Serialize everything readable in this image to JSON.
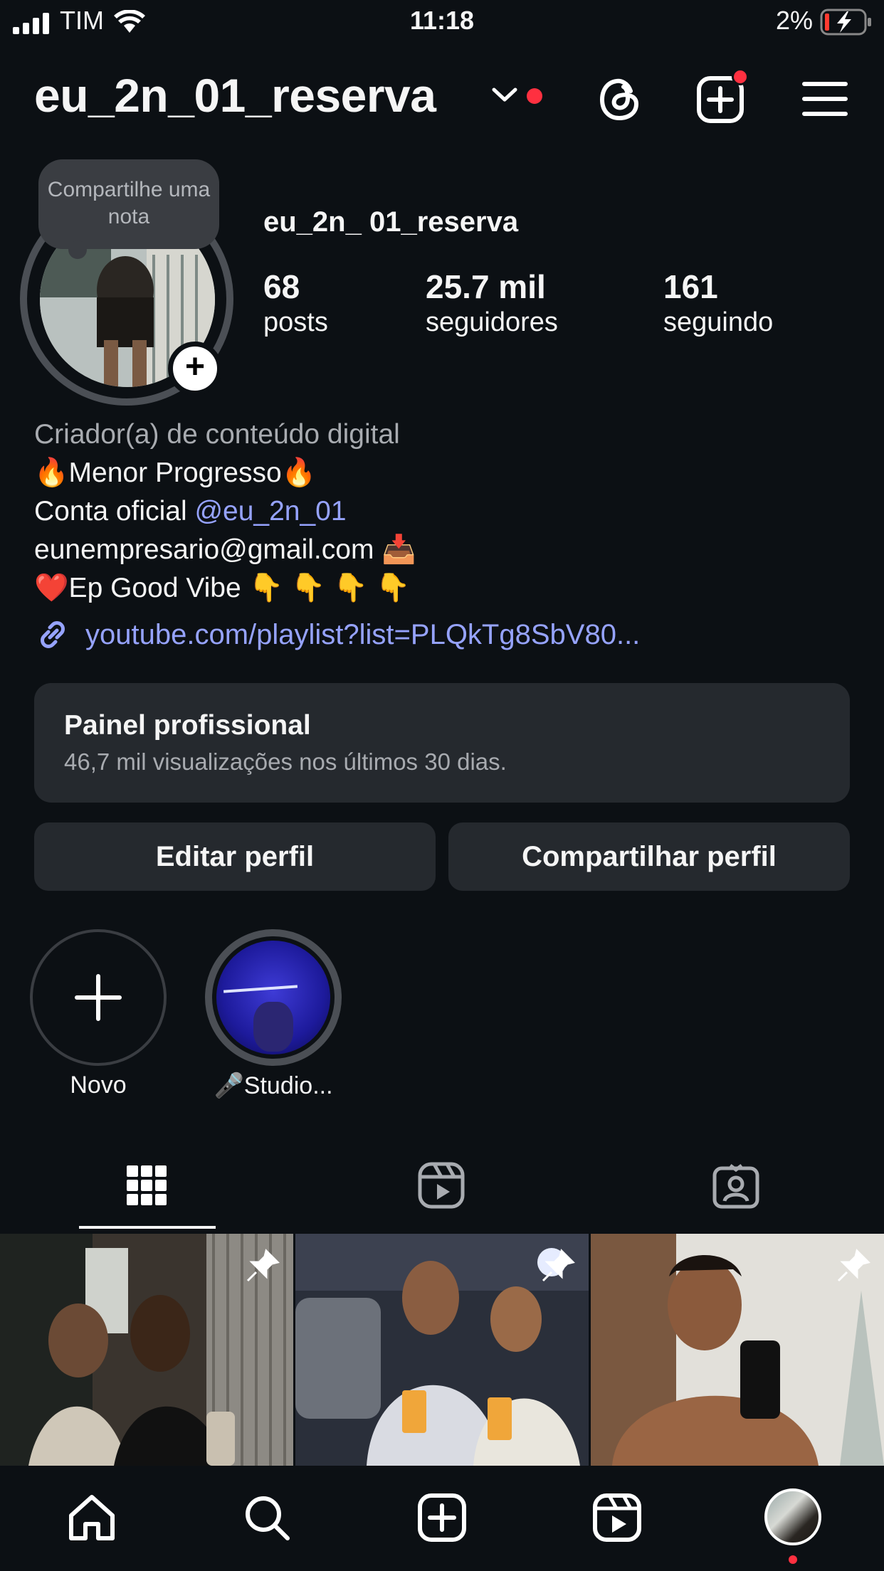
{
  "status_bar": {
    "carrier": "TIM",
    "time": "11:18",
    "battery": "2%"
  },
  "header": {
    "username": "eu_2n_01_reserva",
    "icons": [
      "chevron-down-icon",
      "threads-icon",
      "new-post-icon",
      "menu-icon"
    ]
  },
  "profile": {
    "note": "Compartilhe uma nota",
    "display_name": "eu_2n_ 01_reserva",
    "stats": [
      {
        "value": "68",
        "label": "posts"
      },
      {
        "value": "25.7 mil",
        "label": "seguidores"
      },
      {
        "value": "161",
        "label": "seguindo"
      }
    ]
  },
  "bio": {
    "category": "Criador(a) de conteúdo digital",
    "line1": "🔥Menor Progresso🔥",
    "line2_prefix": "Conta oficial ",
    "line2_mention": "@eu_2n_01",
    "line3": "eunempresario@gmail.com 📥",
    "line4": "❤️Ep Good Vibe 👇 👇 👇 👇",
    "link": "youtube.com/playlist?list=PLQkTg8SbV80..."
  },
  "dashboard": {
    "title": "Painel profissional",
    "subtitle": "46,7 mil visualizações nos últimos 30 dias."
  },
  "buttons": {
    "edit": "Editar perfil",
    "share": "Compartilhar perfil"
  },
  "highlights": [
    {
      "label": "Novo"
    },
    {
      "label": "🎤Studio..."
    }
  ],
  "colors": {
    "background": "#0c1014",
    "surface": "#25292e",
    "link": "#96a3ff",
    "notification": "#ff3040"
  }
}
